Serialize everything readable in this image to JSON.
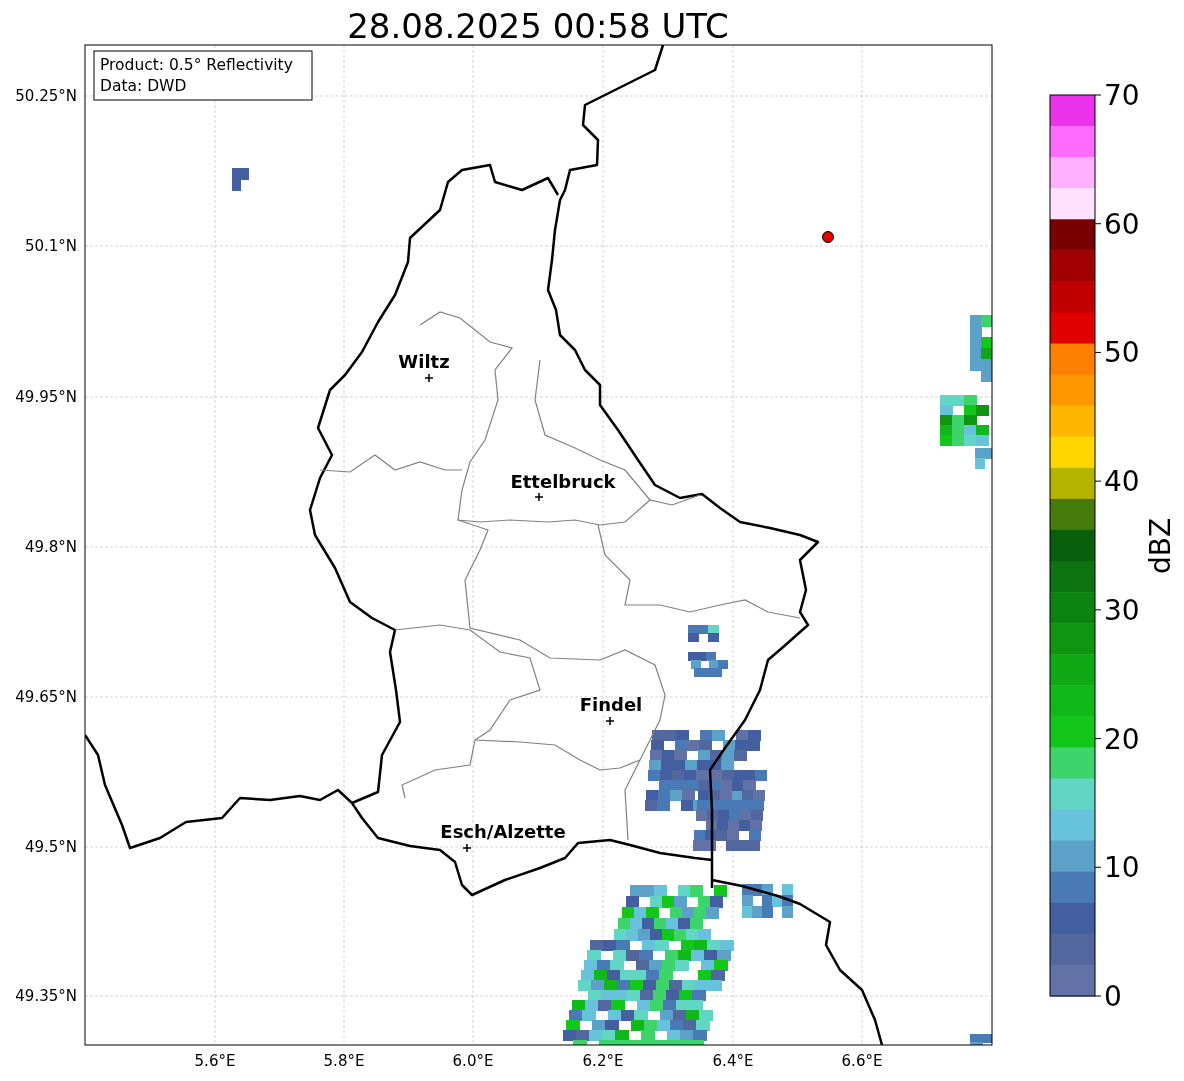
{
  "title": "28.08.2025 00:58 UTC",
  "info_box": [
    "Product: 0.5° Reflectivity",
    "Data: DWD"
  ],
  "cities": [
    {
      "name": "Wiltz"
    },
    {
      "name": "Ettelbruck"
    },
    {
      "name": "Findel"
    },
    {
      "name": "Esch/Alzette"
    }
  ],
  "y_ticks": [
    "50.25°N",
    "50.1°N",
    "49.95°N",
    "49.8°N",
    "49.65°N",
    "49.5°N",
    "49.35°N"
  ],
  "x_ticks": [
    "5.6°E",
    "5.8°E",
    "6.0°E",
    "6.2°E",
    "6.4°E",
    "6.6°E"
  ],
  "colorbar": {
    "label": "dBZ",
    "ticks": [
      "70",
      "60",
      "50",
      "40",
      "30",
      "20",
      "10",
      "0"
    ],
    "segments": [
      {
        "color": "#ec33ec"
      },
      {
        "color": "#ff6aff"
      },
      {
        "color": "#ffb0ff"
      },
      {
        "color": "#ffe0ff"
      },
      {
        "color": "#7a0000"
      },
      {
        "color": "#a00000"
      },
      {
        "color": "#c00000"
      },
      {
        "color": "#e00000"
      },
      {
        "color": "#ff7f00"
      },
      {
        "color": "#ff9800"
      },
      {
        "color": "#ffb600"
      },
      {
        "color": "#ffd700"
      },
      {
        "color": "#b3b300"
      },
      {
        "color": "#467a0a"
      },
      {
        "color": "#075f0b"
      },
      {
        "color": "#0b730f"
      },
      {
        "color": "#0d8410"
      },
      {
        "color": "#0f9510"
      },
      {
        "color": "#10a814"
      },
      {
        "color": "#10b81a"
      },
      {
        "color": "#13c71a"
      },
      {
        "color": "#3dd46c"
      },
      {
        "color": "#62d6c4"
      },
      {
        "color": "#67c2dc"
      },
      {
        "color": "#5ba1c8"
      },
      {
        "color": "#4a7ab5"
      },
      {
        "color": "#435fa0"
      },
      {
        "color": "#53679f"
      },
      {
        "color": "#6272a6"
      }
    ]
  }
}
